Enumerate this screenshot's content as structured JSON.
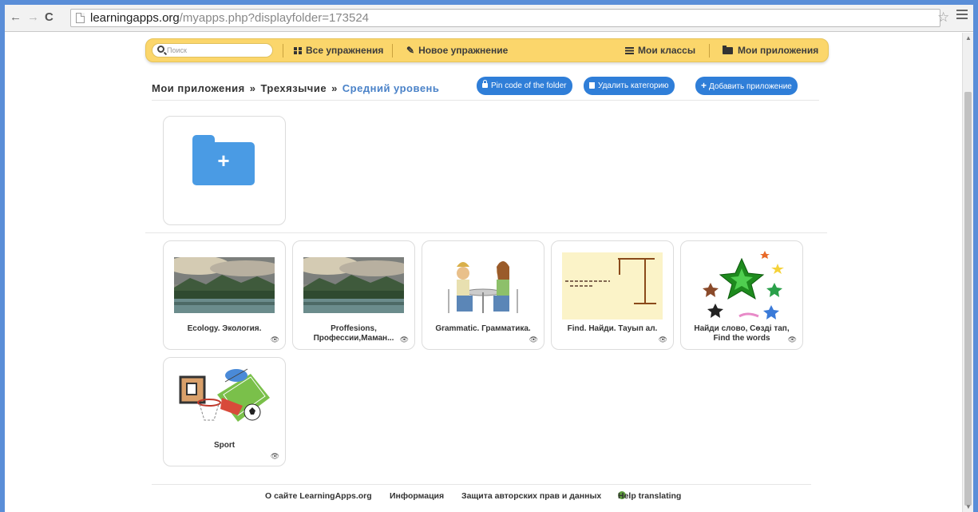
{
  "browser": {
    "url_host": "learningapps.org",
    "url_path": "/myapps.php?displayfolder=173524"
  },
  "nav": {
    "search_placeholder": "Поиск",
    "all_exercises": "Все упражнения",
    "new_exercise": "Новое упражнение",
    "my_classes": "Мои классы",
    "my_apps": "Мои приложения"
  },
  "breadcrumb": {
    "root": "Мои приложения",
    "separator": "»",
    "middle": "Трехязычие",
    "current": "Средний уровень"
  },
  "actions": {
    "pin_code": "Pin code of the folder",
    "delete_category": "Удалить категорию",
    "add_app": "Добавить приложение"
  },
  "apps": [
    {
      "title": "Ecology. Экология."
    },
    {
      "title": "Proffesions, Профессии,Маман..."
    },
    {
      "title": "Grammatic. Грамматика."
    },
    {
      "title": "Find. Найди. Тауып ал."
    },
    {
      "title": "Найди слово, Сөзді тап, Find the words"
    },
    {
      "title": "Sport"
    }
  ],
  "footer": {
    "about": "О сайте LearningApps.org",
    "info": "Информация",
    "privacy": "Защита авторских прав и данных",
    "help": "Help translating"
  },
  "colors": {
    "nav_bg": "#fbd66b",
    "button_blue": "#2f7ed8",
    "folder_blue": "#4a9be4",
    "breadcrumb_current": "#4a82c8"
  }
}
